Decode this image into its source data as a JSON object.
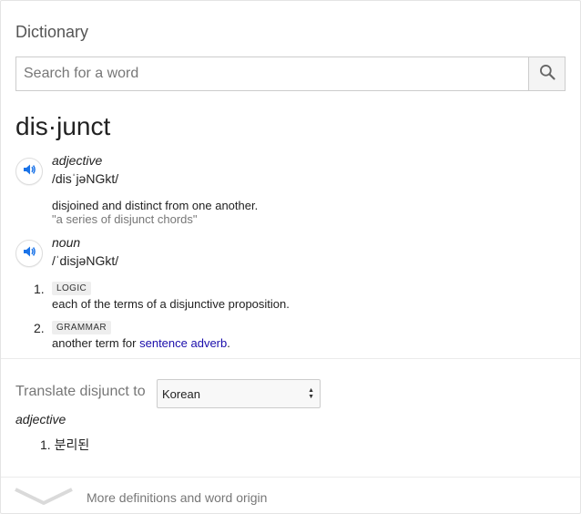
{
  "card": {
    "title": "Dictionary"
  },
  "search": {
    "placeholder": "Search for a word",
    "value": ""
  },
  "entry": {
    "headword": "dis·junct",
    "senses": [
      {
        "pos": "adjective",
        "pronunciation": "/disˈjəNGkt/",
        "definition": "disjoined and distinct from one another.",
        "example": "\"a series of disjunct chords\""
      },
      {
        "pos": "noun",
        "pronunciation": "/ˈdisjəNGkt/",
        "definitions": [
          {
            "number": "1.",
            "tag": "LOGIC",
            "text": "each of the terms of a disjunctive proposition."
          },
          {
            "number": "2.",
            "tag": "GRAMMAR",
            "text_prefix": "another term for ",
            "link": "sentence adverb",
            "text_suffix": "."
          }
        ]
      }
    ]
  },
  "translate": {
    "label": "Translate disjunct to",
    "selected_language": "Korean",
    "pos": "adjective",
    "results": [
      {
        "number": "1.",
        "text": "분리된"
      }
    ]
  },
  "footer": {
    "more_label": "More definitions and word origin"
  },
  "icons": {
    "search": "search-icon",
    "speaker": "speaker-icon",
    "expand": "chevron-down-icon"
  },
  "colors": {
    "speaker_blue": "#1a73e8",
    "link": "#1a0dab",
    "muted_text": "#777777"
  }
}
